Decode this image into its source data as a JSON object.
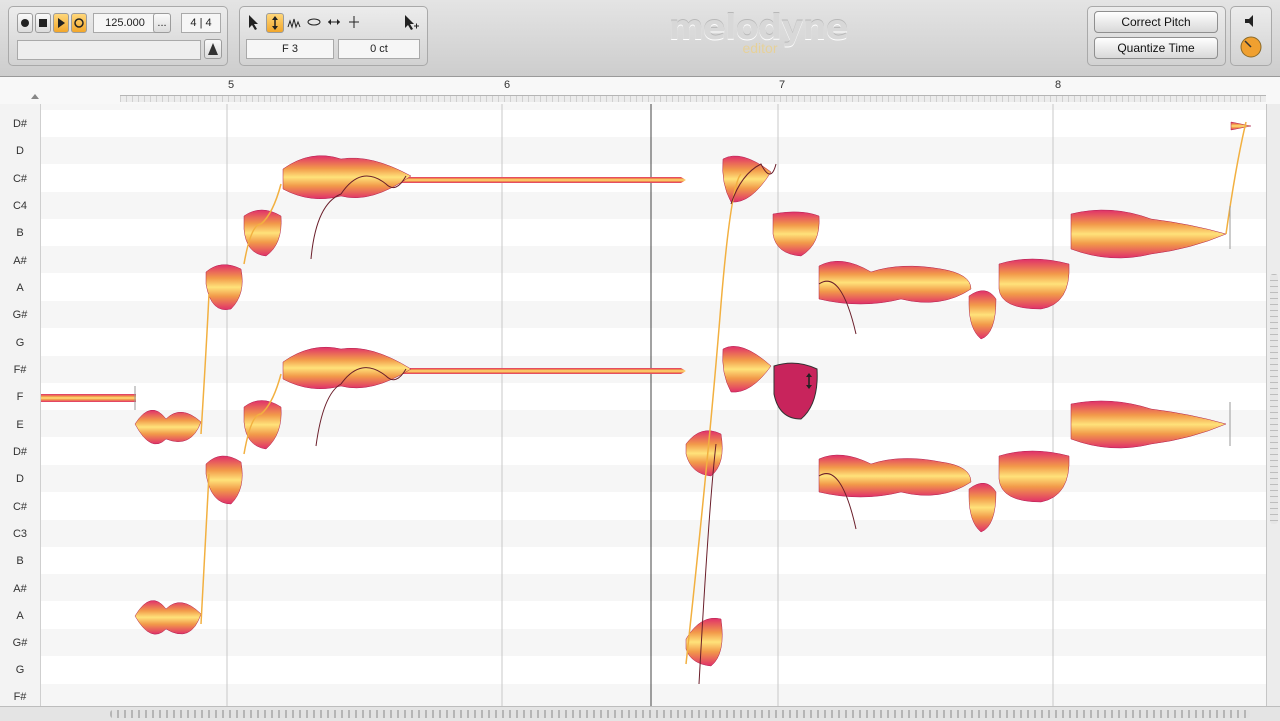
{
  "transport": {
    "tempo": "125.000",
    "tempo_menu": "...",
    "time_signature": "4 | 4"
  },
  "tools": {
    "pitch_value": "F 3",
    "cents_value": "0 ct"
  },
  "logo": {
    "title": "melodyne",
    "subtitle": "editor"
  },
  "actions": {
    "correct_pitch": "Correct Pitch",
    "quantize_time": "Quantize Time"
  },
  "ruler": {
    "bars": [
      "5",
      "6",
      "7",
      "8"
    ]
  },
  "pitch_keys": [
    "D#",
    "D",
    "C#",
    "C4",
    "B",
    "A#",
    "A",
    "G#",
    "G",
    "F#",
    "F",
    "E",
    "D#",
    "D",
    "C#",
    "C3",
    "B",
    "A#",
    "A",
    "G#",
    "G",
    "F#"
  ],
  "colors": {
    "blob_outer": "#e0306a",
    "blob_mid": "#f29a4a",
    "blob_inner": "#ffe27a",
    "selected_blob": "#c8245c"
  }
}
